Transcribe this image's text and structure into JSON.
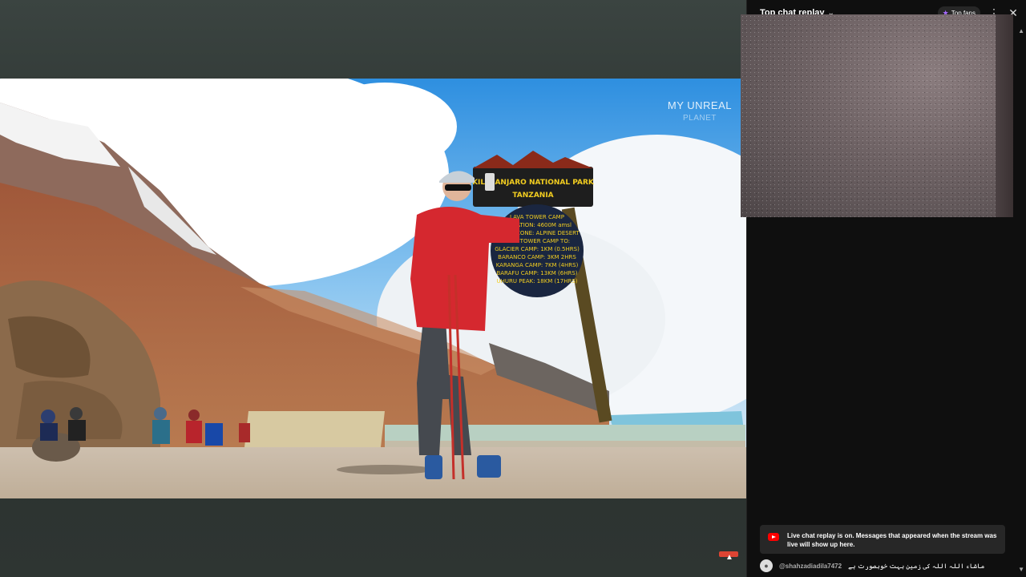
{
  "video": {
    "watermark_line1": "MY UNREAL",
    "watermark_line2": "PLANET",
    "sign_title": "KILIMANJARO NATIONAL PARK",
    "sign_country": "TANZANIA",
    "sign_lines": [
      "LAVA TOWER CAMP",
      "ELEVATION: 4600M amsl",
      "ALPINE ZONE: ALPINE DESERT",
      "LAVA TOWER CAMP TO:",
      "GLACIER CAMP: 1KM (0.5HRS)",
      "BARANCO CAMP: 3KM 2HRS",
      "KARANGA CAMP: 7KM (4HRS)",
      "BARAFU CAMP: 13KM (6HRS)",
      "UHURU PEAK: 18KM (17HRS)"
    ]
  },
  "chat": {
    "title": "Top chat replay",
    "top_fans_label": "Top fans",
    "replay_notice": "Live chat replay is on. Messages that appeared when the stream was live will show up here.",
    "message": {
      "author": "@shahzadiadila7472",
      "text": "ماشاء اللہ اللہ کی زمین بہت خوبصورت ہے"
    }
  },
  "icons": {
    "chevron": "chevron-down-icon",
    "menu": "more-vert-icon",
    "close": "close-icon",
    "star": "star-icon",
    "yt": "youtube-icon"
  }
}
